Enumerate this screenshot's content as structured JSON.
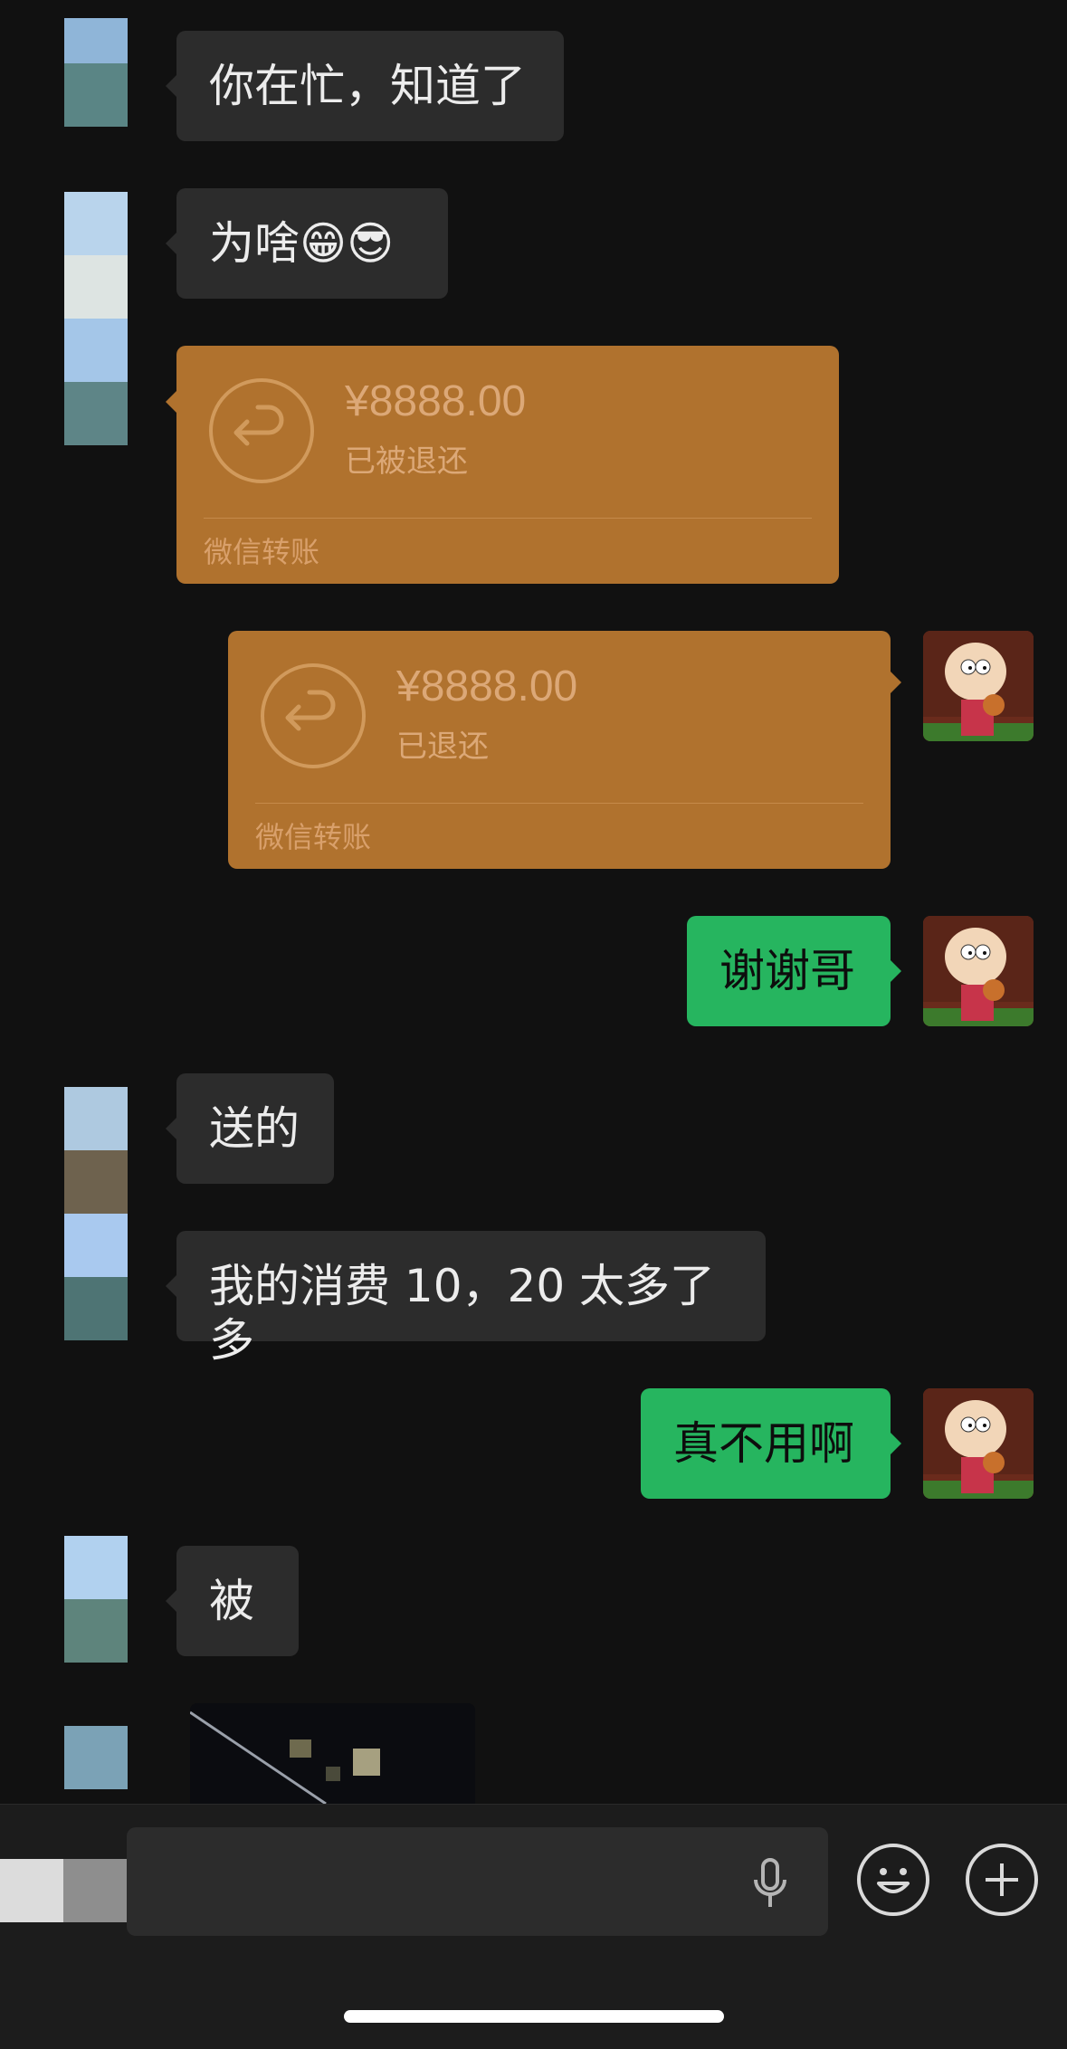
{
  "messages": {
    "m1": {
      "text": "你在忙，知道了"
    },
    "m2": {
      "text": "为啥😁😎"
    },
    "transfer_in": {
      "amount": "¥8888.00",
      "status": "已被退还",
      "label": "微信转账"
    },
    "transfer_out": {
      "amount": "¥8888.00",
      "status": "已退还",
      "label": "微信转账"
    },
    "m3": {
      "text": "谢谢哥"
    },
    "m4": {
      "text": "送的"
    },
    "m5": {
      "text": "我的消费 10，20 太多了多"
    },
    "m6": {
      "text": "真不用啊"
    },
    "m7": {
      "text": "被"
    }
  },
  "colors": {
    "background": "#111111",
    "incoming_bubble": "#2c2c2c",
    "outgoing_bubble": "#26b55f",
    "transfer_card": "#b0722e"
  },
  "icons": {
    "transfer": "return-arrow-icon",
    "voice": "microphone-icon",
    "emoji": "smiley-icon",
    "more": "plus-circle-icon"
  }
}
